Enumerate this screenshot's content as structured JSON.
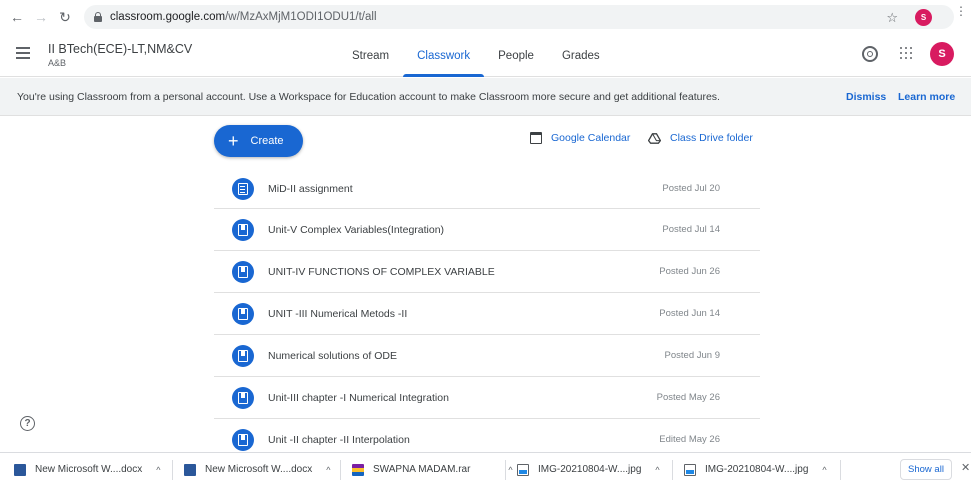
{
  "browser": {
    "url_host": "classroom.google.com",
    "url_path": "/w/MzAxMjM1ODI1ODU1/t/all",
    "profile_initial": "S"
  },
  "header": {
    "class_title": "II BTech(ECE)-LT,NM&CV",
    "class_section": "A&B",
    "tabs": [
      {
        "label": "Stream"
      },
      {
        "label": "Classwork"
      },
      {
        "label": "People"
      },
      {
        "label": "Grades"
      }
    ],
    "active_tab": "Classwork",
    "avatar_initial": "S",
    "avatar_color": "#d81b60"
  },
  "banner": {
    "text": "You're using Classroom from a personal account. Use a Workspace for Education account to make Classroom more secure and get additional features.",
    "dismiss": "Dismiss",
    "learn_more": "Learn more"
  },
  "toolbar": {
    "create": "Create",
    "calendar": "Google Calendar",
    "drive": "Class Drive folder"
  },
  "items": [
    {
      "title": "MiD-II assignment",
      "date": "Posted Jul 20",
      "icon": "assignment-icon"
    },
    {
      "title": "Unit-V Complex Variables(Integration)",
      "date": "Posted Jul 14",
      "icon": "material-icon"
    },
    {
      "title": "UNIT-IV FUNCTIONS OF COMPLEX VARIABLE",
      "date": "Posted Jun 26",
      "icon": "material-icon"
    },
    {
      "title": "UNIT -III Numerical Metods -II",
      "date": "Posted Jun 14",
      "icon": "material-icon"
    },
    {
      "title": "Numerical solutions of ODE",
      "date": "Posted Jun 9",
      "icon": "material-icon"
    },
    {
      "title": "Unit-III chapter -I Numerical Integration",
      "date": "Posted May 26",
      "icon": "material-icon"
    },
    {
      "title": "Unit -II chapter -II Interpolation",
      "date": "Edited May 26",
      "icon": "material-icon"
    }
  ],
  "downloads": [
    {
      "name": "New Microsoft W....docx",
      "type": "word"
    },
    {
      "name": "New Microsoft W....docx",
      "type": "word"
    },
    {
      "name": "SWAPNA MADAM.rar",
      "type": "rar"
    },
    {
      "name": "IMG-20210804-W....jpg",
      "type": "jpg"
    },
    {
      "name": "IMG-20210804-W....jpg",
      "type": "jpg"
    }
  ],
  "show_all": "Show all",
  "colors": {
    "accent": "#1967d2",
    "avatar": "#d81b60"
  }
}
